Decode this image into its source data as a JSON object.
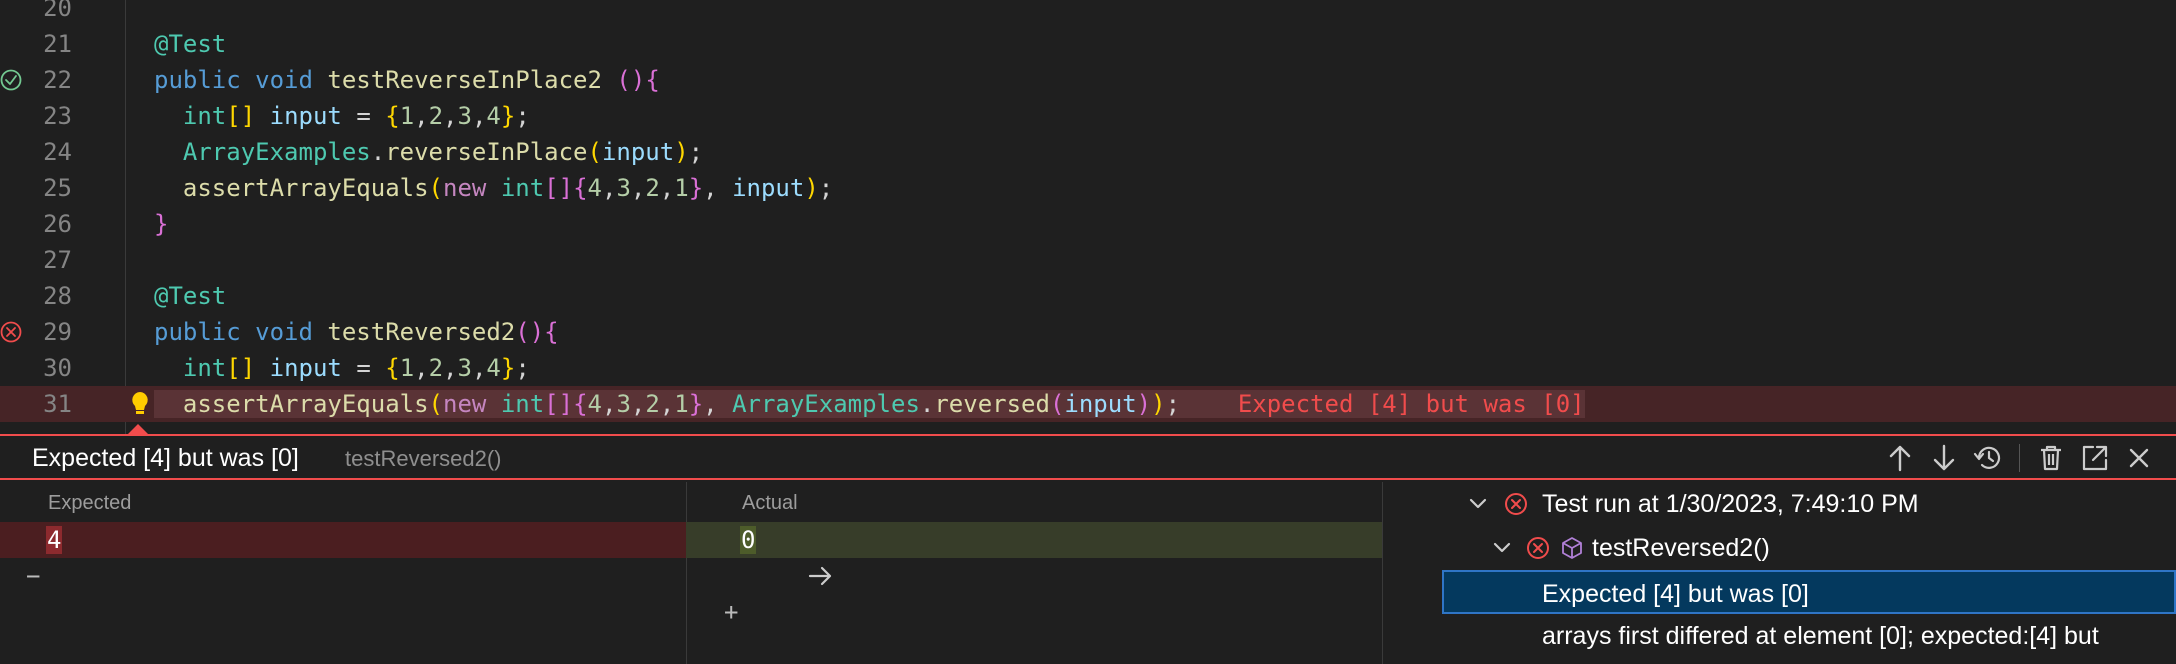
{
  "editor": {
    "lines": [
      {
        "num": "20",
        "tokens": []
      },
      {
        "num": "21",
        "tokens": [
          [
            "tk-ann",
            "@Test"
          ]
        ]
      },
      {
        "num": "22",
        "status": "pass",
        "tokens": [
          [
            "tk-kw",
            "public"
          ],
          [
            "tk-pl",
            " "
          ],
          [
            "tk-kw",
            "void"
          ],
          [
            "tk-pl",
            " "
          ],
          [
            "tk-fn",
            "testReverseInPlace2"
          ],
          [
            "tk-pl",
            " "
          ],
          [
            "tk-p1",
            "()"
          ],
          [
            "tk-p1",
            "{"
          ]
        ]
      },
      {
        "num": "23",
        "tokens": [
          [
            "tk-pl",
            "  "
          ],
          [
            "tk-type",
            "int"
          ],
          [
            "tk-p2",
            "[]"
          ],
          [
            "tk-pl",
            " "
          ],
          [
            "tk-var",
            "input"
          ],
          [
            "tk-pl",
            " = "
          ],
          [
            "tk-p2",
            "{"
          ],
          [
            "tk-num",
            "1"
          ],
          [
            "tk-pl",
            ","
          ],
          [
            "tk-num",
            "2"
          ],
          [
            "tk-pl",
            ","
          ],
          [
            "tk-num",
            "3"
          ],
          [
            "tk-pl",
            ","
          ],
          [
            "tk-num",
            "4"
          ],
          [
            "tk-p2",
            "}"
          ],
          [
            "tk-pl",
            ";"
          ]
        ]
      },
      {
        "num": "24",
        "tokens": [
          [
            "tk-pl",
            "  "
          ],
          [
            "tk-type",
            "ArrayExamples"
          ],
          [
            "tk-pl",
            "."
          ],
          [
            "tk-fn",
            "reverseInPlace"
          ],
          [
            "tk-p2",
            "("
          ],
          [
            "tk-var",
            "input"
          ],
          [
            "tk-p2",
            ")"
          ],
          [
            "tk-pl",
            ";"
          ]
        ]
      },
      {
        "num": "25",
        "tokens": [
          [
            "tk-pl",
            "  "
          ],
          [
            "tk-fn",
            "assertArrayEquals"
          ],
          [
            "tk-p2",
            "("
          ],
          [
            "tk-ctl",
            "new"
          ],
          [
            "tk-pl",
            " "
          ],
          [
            "tk-type",
            "int"
          ],
          [
            "tk-p1",
            "[]"
          ],
          [
            "tk-p1",
            "{"
          ],
          [
            "tk-num",
            "4"
          ],
          [
            "tk-pl",
            ","
          ],
          [
            "tk-num",
            "3"
          ],
          [
            "tk-pl",
            ","
          ],
          [
            "tk-num",
            "2"
          ],
          [
            "tk-pl",
            ","
          ],
          [
            "tk-num",
            "1"
          ],
          [
            "tk-p1",
            "}"
          ],
          [
            "tk-pl",
            ", "
          ],
          [
            "tk-var",
            "input"
          ],
          [
            "tk-p2",
            ")"
          ],
          [
            "tk-pl",
            ";"
          ]
        ]
      },
      {
        "num": "26",
        "tokens": [
          [
            "tk-p1",
            "}"
          ]
        ]
      },
      {
        "num": "27",
        "tokens": []
      },
      {
        "num": "28",
        "tokens": [
          [
            "tk-ann",
            "@Test"
          ]
        ]
      },
      {
        "num": "29",
        "status": "fail",
        "tokens": [
          [
            "tk-kw",
            "public"
          ],
          [
            "tk-pl",
            " "
          ],
          [
            "tk-kw",
            "void"
          ],
          [
            "tk-pl",
            " "
          ],
          [
            "tk-fn",
            "testReversed2"
          ],
          [
            "tk-p1",
            "()"
          ],
          [
            "tk-p1",
            "{"
          ]
        ]
      },
      {
        "num": "30",
        "tokens": [
          [
            "tk-pl",
            "  "
          ],
          [
            "tk-type",
            "int"
          ],
          [
            "tk-p2",
            "[]"
          ],
          [
            "tk-pl",
            " "
          ],
          [
            "tk-var",
            "input"
          ],
          [
            "tk-pl",
            " = "
          ],
          [
            "tk-p2",
            "{"
          ],
          [
            "tk-num",
            "1"
          ],
          [
            "tk-pl",
            ","
          ],
          [
            "tk-num",
            "2"
          ],
          [
            "tk-pl",
            ","
          ],
          [
            "tk-num",
            "3"
          ],
          [
            "tk-pl",
            ","
          ],
          [
            "tk-num",
            "4"
          ],
          [
            "tk-p2",
            "}"
          ],
          [
            "tk-pl",
            ";"
          ]
        ]
      },
      {
        "num": "31",
        "error": true,
        "tokens": [
          [
            "tk-pl",
            "  "
          ],
          [
            "tk-fn",
            "assertArrayEquals"
          ],
          [
            "tk-p2",
            "("
          ],
          [
            "tk-ctl",
            "new"
          ],
          [
            "tk-pl",
            " "
          ],
          [
            "tk-type",
            "int"
          ],
          [
            "tk-p1",
            "[]"
          ],
          [
            "tk-p1",
            "{"
          ],
          [
            "tk-num",
            "4"
          ],
          [
            "tk-pl",
            ","
          ],
          [
            "tk-num",
            "3"
          ],
          [
            "tk-pl",
            ","
          ],
          [
            "tk-num",
            "2"
          ],
          [
            "tk-pl",
            ","
          ],
          [
            "tk-num",
            "1"
          ],
          [
            "tk-p1",
            "}"
          ],
          [
            "tk-pl",
            ", "
          ],
          [
            "tk-type",
            "ArrayExamples"
          ],
          [
            "tk-pl",
            "."
          ],
          [
            "tk-fn",
            "reversed"
          ],
          [
            "tk-p1",
            "("
          ],
          [
            "tk-var",
            "input"
          ],
          [
            "tk-p1",
            ")"
          ],
          [
            "tk-p2",
            ")"
          ],
          [
            "tk-pl",
            ";"
          ]
        ],
        "inline_message": "Expected [4] but was [0]"
      }
    ]
  },
  "peek": {
    "title": "Expected [4] but was [0]",
    "subtitle": "testReversed2()",
    "actions": [
      "arrow-up-icon",
      "arrow-down-icon",
      "history-icon",
      "trash-icon",
      "open-external-icon",
      "close-icon"
    ],
    "expected_label": "Expected",
    "actual_label": "Actual",
    "expected_sign": "−",
    "expected_value": "4",
    "actual_sign": "+",
    "actual_value": "0",
    "tree": {
      "run": "Test run at 1/30/2023, 7:49:10 PM",
      "test": "testReversed2()",
      "message": "Expected [4] but was [0]",
      "detail": "arrays first differed at element [0]; expected:[4] but"
    }
  },
  "colors": {
    "error": "#f14c4c",
    "pass": "#73c991",
    "selection": "#04395e"
  }
}
